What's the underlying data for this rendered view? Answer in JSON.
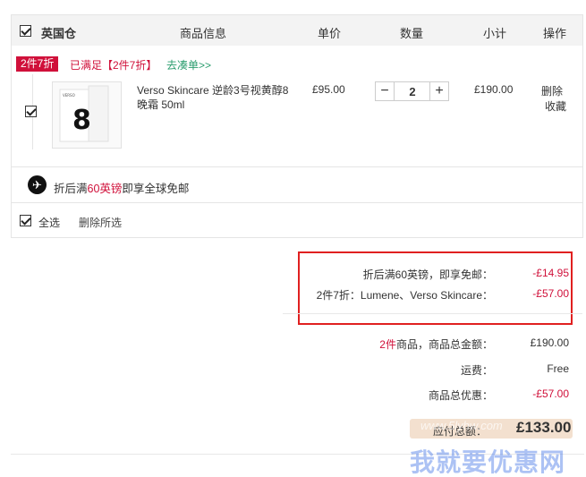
{
  "header": {
    "store": "英国仓",
    "info": "商品信息",
    "price": "单价",
    "qty": "数量",
    "subtotal": "小计",
    "op": "操作"
  },
  "promo": {
    "tag": "2件7折",
    "met": "已满足【2件7折】",
    "link": "去凑单>>"
  },
  "item": {
    "name": "Verso Skincare 逆龄3号视黄醇8晚霜 50ml",
    "price": "£95.00",
    "qty": "2",
    "minus": "−",
    "plus": "+",
    "subtotal": "£190.00",
    "delete": "删除",
    "favorite": "收藏",
    "thumb_text": "VERSO"
  },
  "shipping": {
    "pre": "折后满",
    "highlight": "60英镑",
    "post": "即享全球免邮"
  },
  "footer": {
    "select_all": "全选",
    "delete_selected": "删除所选"
  },
  "summary": {
    "shipping_discount_label": "折后满60英镑，即享免邮：",
    "shipping_discount_value": "-£14.95",
    "promo_discount_label": "2件7折：Lumene、Verso Skincare：",
    "promo_discount_value": "-£57.00",
    "count_highlight": "2件",
    "count_label": "商品，商品总金额：",
    "goods_total": "£190.00",
    "freight_label": "运费：",
    "freight_value": "Free",
    "discount_total_label": "商品总优惠：",
    "discount_total_value": "-£57.00",
    "pay_label": "应付总额：",
    "pay_value": "£133.00"
  },
  "watermark": {
    "small": "www.5lyhw.com",
    "big": "我就要优惠网"
  },
  "colors": {
    "accent_red": "#d0103a",
    "link_green": "#2a9d6e"
  }
}
